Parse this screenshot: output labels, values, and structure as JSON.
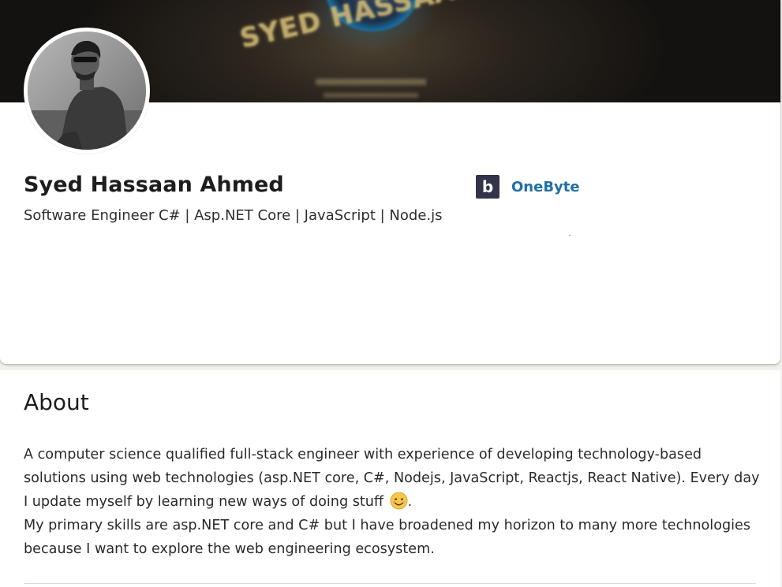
{
  "cover": {
    "text": "SYED HASSAAN AHMED"
  },
  "profile": {
    "name": "Syed Hassaan Ahmed",
    "headline": "Software Engineer C# | Asp.NET Core | JavaScript | Node.js",
    "avatar_icon": "profile-photo"
  },
  "company": {
    "logo_letter": "b",
    "name": "OneByte",
    "link_color": "#1f6fa5",
    "logo_bg": "#33344a"
  },
  "about": {
    "title": "About",
    "paragraph_1": "A computer science qualified full-stack engineer with experience of developing technology-based solutions using web technologies (asp.NET core, C#, Nodejs, JavaScript, Reactjs, React Native). Every day I update myself by learning new ways of doing stuff",
    "paragraph_1_end": ".",
    "paragraph_2": "My primary skills are asp.NET core and C# but I have broadened my horizon to many more technologies because I want to explore the web engineering ecosystem.",
    "emoji_icon": "smiling-face-icon"
  }
}
